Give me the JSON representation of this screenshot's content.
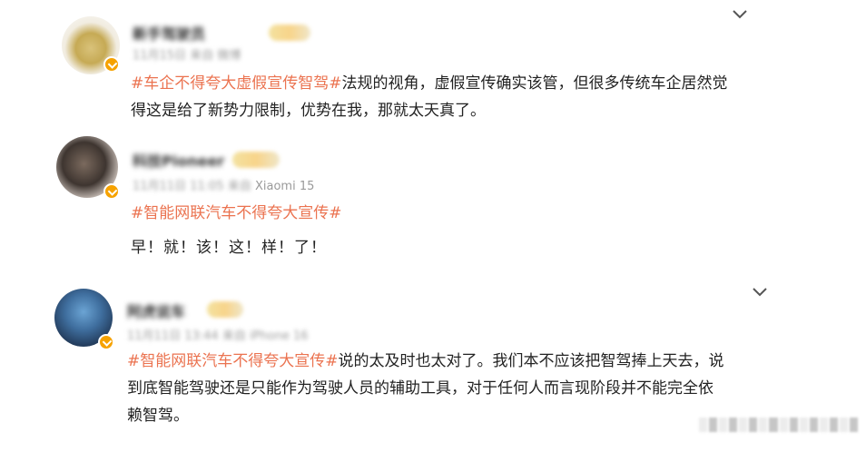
{
  "posts": [
    {
      "username": "新手驾驶员",
      "meta": "11月15日 来自 微博",
      "hashtag": "#车企不得夸大虚假宣传智驾#",
      "body_line1": "法规的视角，虚假宣传确实该管，但很多传统车企居然觉",
      "body_line2": "得这是给了新势力限制，优势在我，那就太天真了。"
    },
    {
      "username": "科技Pioneer",
      "meta_blurred": "11月11日 11:05 来自",
      "meta_device": "Xiaomi 15",
      "hashtag": "#智能网联汽车不得夸大宣传#",
      "body_line2": "早！就！该！这！样！了！"
    },
    {
      "username": "阿虎说车",
      "meta_blurred": "11月11日 13:44 来自 iPhone 16",
      "hashtag": "#智能网联汽车不得夸大宣传#",
      "body_line1": "说的太及时也太对了。我们本不应该把智驾捧上天去，说",
      "body_line2": "到底智能驾驶还是只能作为驾驶人员的辅助工具，对于任何人而言现阶段并不能完全依",
      "body_line3": "赖智驾。"
    }
  ],
  "icons": {
    "verified": "verified-badge-icon",
    "more": "chevron-down-icon"
  },
  "colors": {
    "hashtag": "#eb7350",
    "verified": "#f6a200"
  }
}
